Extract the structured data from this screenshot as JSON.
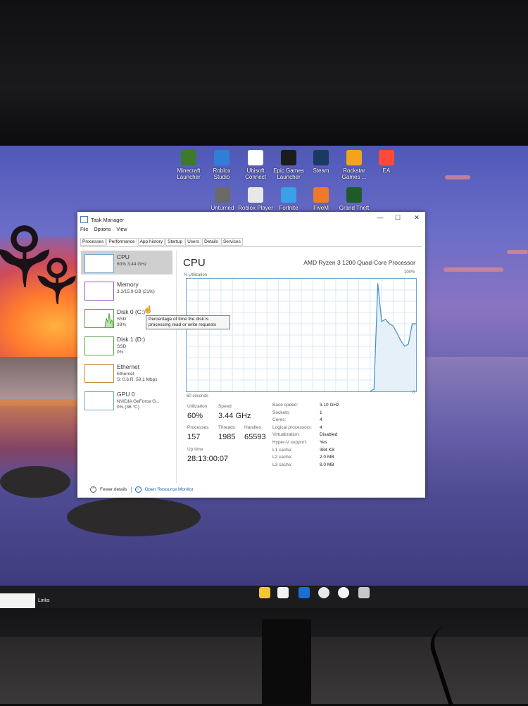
{
  "desktop_icons": [
    {
      "id": "minecraft",
      "label": "Minecraft\nLauncher",
      "icon": "minecraft-icon",
      "color": "#3d7a2b"
    },
    {
      "id": "roblox-studio",
      "label": "Roblox\nStudio",
      "icon": "roblox-studio-icon",
      "color": "#2f7fd8"
    },
    {
      "id": "ubisoft",
      "label": "Ubisoft\nConnect",
      "icon": "ubisoft-icon",
      "color": "#ffffff"
    },
    {
      "id": "epic",
      "label": "Epic Games\nLauncher",
      "icon": "epic-games-icon",
      "color": "#1c1c1c"
    },
    {
      "id": "steam",
      "label": "Steam",
      "icon": "steam-icon",
      "color": "#1a3a63"
    },
    {
      "id": "rockstar",
      "label": "Rockstar\nGames ...",
      "icon": "rockstar-icon",
      "color": "#f2a51c"
    },
    {
      "id": "ea",
      "label": "EA",
      "icon": "ea-icon",
      "color": "#ff4a3a"
    },
    {
      "id": "unturned",
      "label": "Unturned",
      "icon": "unturned-icon",
      "color": "#6a6a6a"
    },
    {
      "id": "roblox-player",
      "label": "Roblox Player",
      "icon": "roblox-player-icon",
      "color": "#e8e8e8"
    },
    {
      "id": "fortnite",
      "label": "Fortnite",
      "icon": "fortnite-icon",
      "color": "#3aa0e8"
    },
    {
      "id": "fivem",
      "label": "FiveM",
      "icon": "fivem-icon",
      "color": "#f07a2a"
    },
    {
      "id": "gta",
      "label": "Grand Theft\nAuto V",
      "icon": "gta-v-icon",
      "color": "#1e5a2a"
    }
  ],
  "task_manager": {
    "title": "Task Manager",
    "menu": [
      "File",
      "Options",
      "View"
    ],
    "tabs": [
      "Processes",
      "Performance",
      "App history",
      "Startup",
      "Users",
      "Details",
      "Services"
    ],
    "active_tab": "Performance",
    "sidebar": [
      {
        "name": "CPU",
        "sub1": "60% 3.44 GHz",
        "sub2": "",
        "selected": true,
        "color": "#6fa6cf"
      },
      {
        "name": "Memory",
        "sub1": "3.3/15.9 GB (21%)",
        "sub2": "",
        "selected": false,
        "color": "#9a5cb5"
      },
      {
        "name": "Disk 0 (C:)",
        "sub1": "SSD",
        "sub2": "38%",
        "selected": false,
        "color": "#5aa64a"
      },
      {
        "name": "Disk 1 (D:)",
        "sub1": "SSD",
        "sub2": "0%",
        "selected": false,
        "color": "#5aa64a"
      },
      {
        "name": "Ethernet",
        "sub1": "Ethernet",
        "sub2": "S: 0.6 R: 59.1 Mbps",
        "selected": false,
        "color": "#c98a3c"
      },
      {
        "name": "GPU 0",
        "sub1": "NVIDIA GeForce G...",
        "sub2": "0% (36 °C)",
        "selected": false,
        "color": "#6fa6cf"
      }
    ],
    "tooltip": "Percentage of time the disk is processing read or write requests",
    "main": {
      "title": "CPU",
      "processor": "AMD Ryzen 3 1200 Quad-Core Processor",
      "util_label": "% Utilization",
      "max_label": "100%",
      "time_label": "60 seconds",
      "zero_label": "0",
      "utilization_label": "Utilization",
      "utilization": "60%",
      "speed_label": "Speed",
      "speed": "3.44 GHz",
      "processes_label": "Processes",
      "processes": "157",
      "threads_label": "Threads",
      "threads": "1985",
      "handles_label": "Handles",
      "handles": "65593",
      "uptime_label": "Up time",
      "uptime": "28:13:00:07",
      "specs": [
        {
          "label": "Base speed:",
          "value": "3.10 GHz"
        },
        {
          "label": "Sockets:",
          "value": "1"
        },
        {
          "label": "Cores:",
          "value": "4"
        },
        {
          "label": "Logical processors:",
          "value": "4"
        },
        {
          "label": "Virtualization:",
          "value": "Disabled"
        },
        {
          "label": "Hyper-V support:",
          "value": "Yes"
        },
        {
          "label": "L1 cache:",
          "value": "384 KB"
        },
        {
          "label": "L2 cache:",
          "value": "2.0 MB"
        },
        {
          "label": "L3 cache:",
          "value": "8.0 MB"
        }
      ],
      "cpu_history_percent": [
        0,
        0,
        0,
        0,
        0,
        0,
        0,
        0,
        0,
        0,
        0,
        0,
        0,
        0,
        0,
        0,
        0,
        0,
        0,
        0,
        0,
        0,
        0,
        0,
        0,
        0,
        0,
        0,
        0,
        0,
        0,
        0,
        0,
        0,
        0,
        0,
        0,
        0,
        0,
        0,
        0,
        0,
        0,
        0,
        0,
        0,
        0,
        0,
        0,
        2,
        96,
        62,
        64,
        60,
        58,
        52,
        45,
        40,
        42,
        60,
        60
      ]
    },
    "footer": {
      "fewer": "Fewer details",
      "monitor": "Open Resource Monitor"
    }
  },
  "taskbar": {
    "links_label": "Links",
    "icons": [
      {
        "name": "file-explorer-icon",
        "color": "#f2c53a"
      },
      {
        "name": "microsoft-store-icon",
        "color": "#f2f2f2"
      },
      {
        "name": "outlook-icon",
        "color": "#1a6fd1"
      },
      {
        "name": "chrome-icon",
        "color": "#e8e8e8"
      },
      {
        "name": "app-icon",
        "color": "#f4f4f4"
      },
      {
        "name": "task-manager-taskbar-icon",
        "color": "#c8c8c8"
      }
    ]
  }
}
